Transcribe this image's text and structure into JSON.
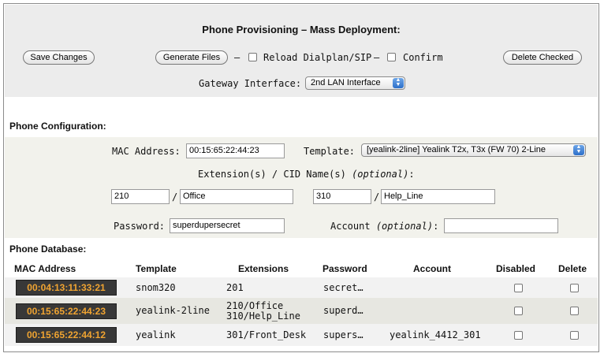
{
  "page": {
    "title": "Phone Provisioning – Mass Deployment:"
  },
  "toolbar": {
    "save_label": "Save Changes",
    "generate_label": "Generate Files",
    "dash1": "–",
    "reload_label": "Reload Dialplan/SIP",
    "dash2": "–",
    "confirm_label": "Confirm",
    "delete_checked_label": "Delete Checked",
    "gateway_label": "Gateway Interface:",
    "gateway_value": "2nd LAN Interface"
  },
  "config": {
    "section_label": "Phone Configuration:",
    "mac_label": "MAC Address:",
    "mac_value": "00:15:65:22:44:23",
    "template_label": "Template:",
    "template_value": "[yealink-2line] Yealink T2x, T3x (FW 70) 2-Line",
    "ext_label": "Extension(s) / CID Name(s)",
    "ext_optional": "(optional)",
    "ext_colon": ":",
    "ext1": "210",
    "cid1": "Office",
    "ext2": "310",
    "cid2": "Help_Line",
    "slash": "/",
    "password_label": "Password:",
    "password_value": "superdupersecret",
    "account_label": "Account",
    "account_optional": "(optional)",
    "account_colon": ":",
    "account_value": ""
  },
  "database": {
    "section_label": "Phone Database:",
    "columns": [
      "MAC Address",
      "Template",
      "Extensions",
      "Password",
      "Account",
      "Disabled",
      "Delete"
    ],
    "rows": [
      {
        "mac": "00:04:13:11:33:21",
        "template": "snom320",
        "ext_line1": "201",
        "ext_line2": "",
        "password": "secret…",
        "account": ""
      },
      {
        "mac": "00:15:65:22:44:23",
        "template": "yealink-2line",
        "ext_line1": "210/Office",
        "ext_line2": "310/Help_Line",
        "password": "superd…",
        "account": ""
      },
      {
        "mac": "00:15:65:22:44:12",
        "template": "yealink",
        "ext_line1": "301/Front_Desk",
        "ext_line2": "",
        "password": "supers…",
        "account": "yealink_4412_301"
      }
    ]
  },
  "colors": {
    "mac_badge_bg": "#383838",
    "mac_badge_text": "#f0a431",
    "select_arrow": "#2d6fc9"
  }
}
